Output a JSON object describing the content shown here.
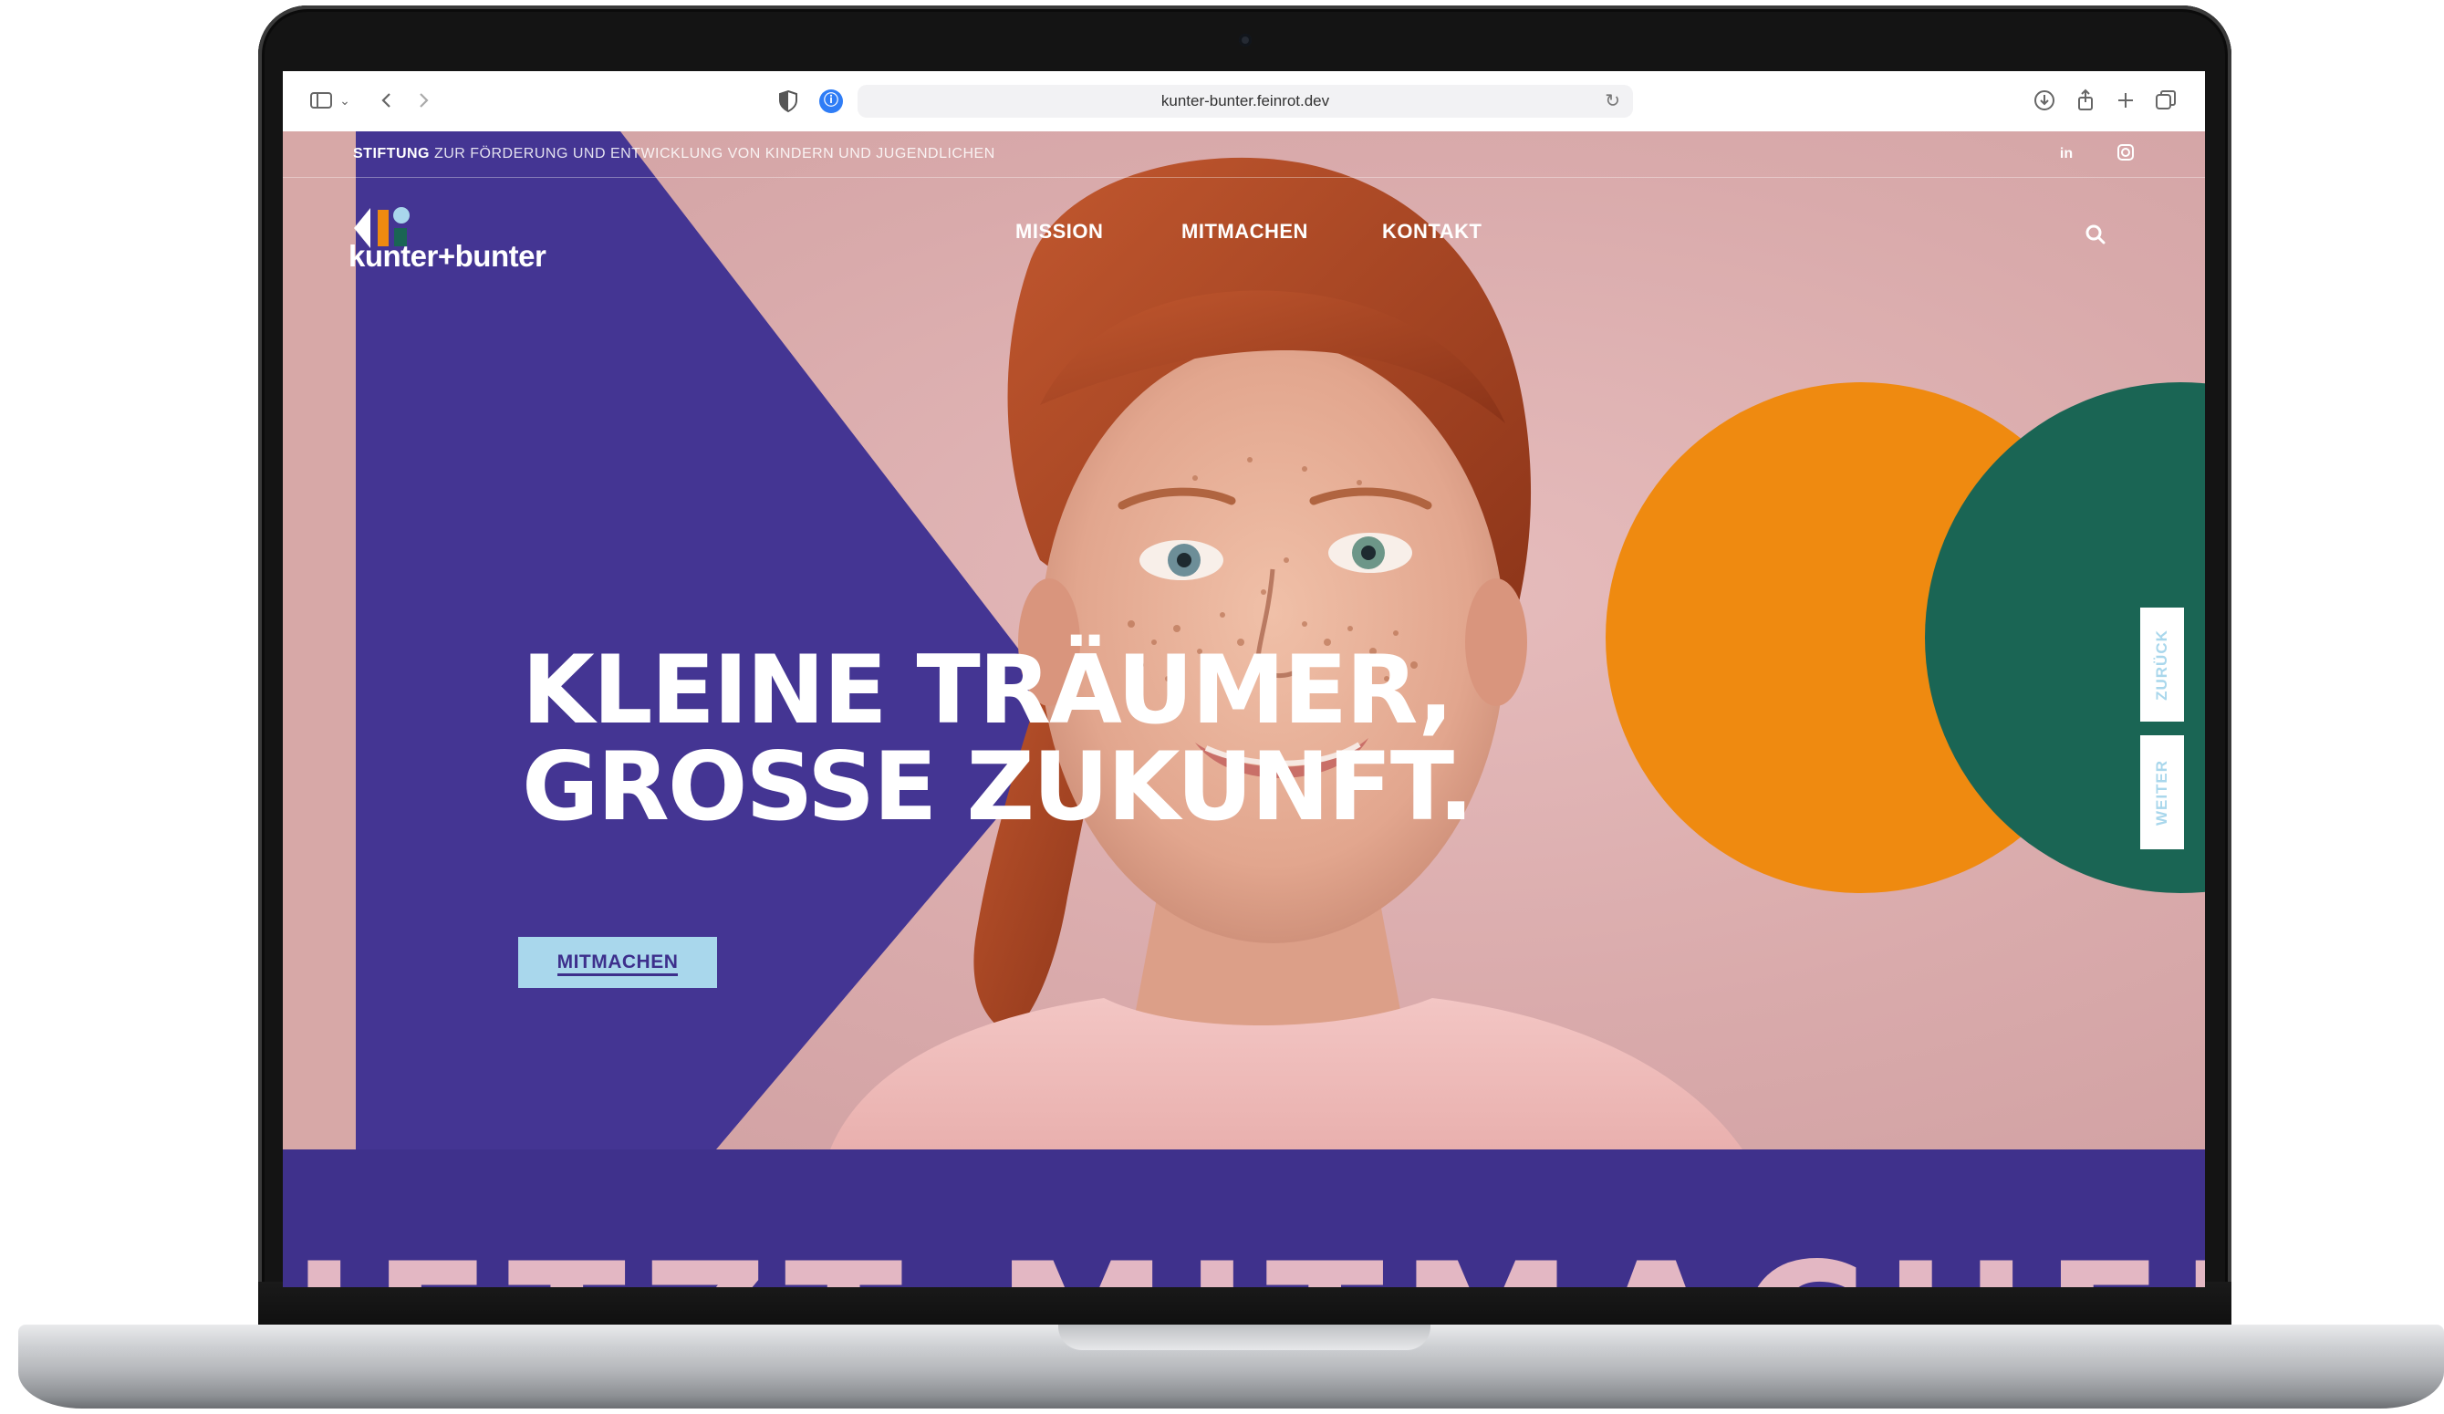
{
  "browser": {
    "url": "kunter-bunter.feinrot.dev"
  },
  "site": {
    "tagline_bold": "STIFTUNG",
    "tagline_rest": " ZUR FÖRDERUNG UND ENTWICKLUNG VON KINDERN UND JUGENDLICHEN",
    "social": {
      "linkedin": "in",
      "instagram": "◘"
    },
    "logo_text": "kunter+bunter",
    "nav": [
      {
        "label": "MISSION"
      },
      {
        "label": "MITMACHEN"
      },
      {
        "label": "KONTAKT"
      }
    ],
    "hero": {
      "line1": "KLEINE TRÄUMER,",
      "line2": "GROSSE ZUKUNFT.",
      "cta": "MITMACHEN"
    },
    "pager": {
      "back": "ZURÜCK",
      "next": "WEITER"
    },
    "marquee": "JETZT MITMACHEN! JETZT MITMACHEN!"
  },
  "colors": {
    "violet": "#443593",
    "orange": "#ef8a10",
    "green": "#1a6554",
    "pink": "#dcb0b0",
    "light_blue": "#a9d7ec"
  },
  "icons": {
    "sidebar": "sidebar-icon",
    "back": "chevron-left-icon",
    "forward": "chevron-right-icon",
    "download": "download-icon",
    "share": "share-icon",
    "new_tab": "plus-icon",
    "tabs": "tabs-overview-icon",
    "search": "search-icon"
  }
}
